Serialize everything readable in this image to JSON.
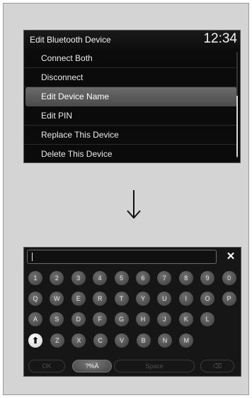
{
  "menu_screen": {
    "title": "Edit Bluetooth Device",
    "clock": "12:34",
    "items": [
      {
        "label": "Connect Both"
      },
      {
        "label": "Disconnect"
      },
      {
        "label": "Edit Device Name",
        "selected": true
      },
      {
        "label": "Edit PIN"
      },
      {
        "label": "Replace This Device"
      },
      {
        "label": "Delete This Device"
      }
    ]
  },
  "keyboard_screen": {
    "input_value": "",
    "clear_label": "✕",
    "row1": [
      "1",
      "2",
      "3",
      "4",
      "5",
      "6",
      "7",
      "8",
      "9",
      "0"
    ],
    "row2": [
      "Q",
      "W",
      "E",
      "R",
      "T",
      "Y",
      "U",
      "I",
      "O",
      "P"
    ],
    "row3": [
      "A",
      "S",
      "D",
      "F",
      "G",
      "H",
      "J",
      "K",
      "L"
    ],
    "row4": [
      "Z",
      "X",
      "C",
      "V",
      "B",
      "N",
      "M"
    ],
    "shift_label": "⬆",
    "ok_label": "OK",
    "symbols_label": "?%Ä",
    "space_label": "Space",
    "delete_label": "⌫"
  },
  "colors": {
    "frame_bg": "#d4d4d4",
    "screen_bg": "#0b0b0b",
    "selected_row": "#5a5a5a"
  },
  "icons": {
    "arrow": "down-arrow-icon",
    "clear": "close-icon",
    "shift": "shift-arrow-icon",
    "delete": "backspace-icon"
  }
}
